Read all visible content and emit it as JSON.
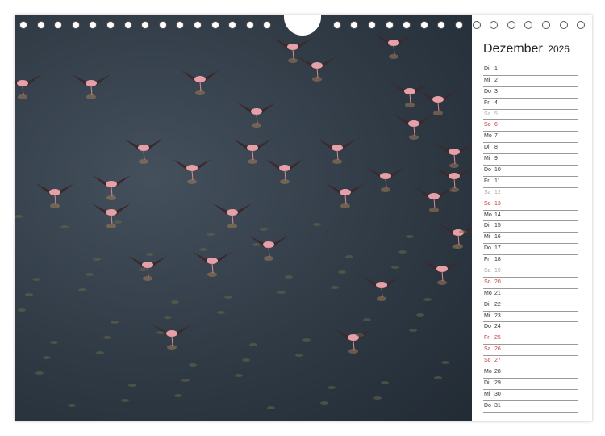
{
  "calendar": {
    "month": "Dezember",
    "year": "2026",
    "days": [
      {
        "weekday": "Di",
        "day": "1",
        "type": "weekday"
      },
      {
        "weekday": "Mi",
        "day": "2",
        "type": "weekday"
      },
      {
        "weekday": "Do",
        "day": "3",
        "type": "weekday"
      },
      {
        "weekday": "Fr",
        "day": "4",
        "type": "weekday"
      },
      {
        "weekday": "Sa",
        "day": "5",
        "type": "sat"
      },
      {
        "weekday": "So",
        "day": "6",
        "type": "sun"
      },
      {
        "weekday": "Mo",
        "day": "7",
        "type": "weekday"
      },
      {
        "weekday": "Di",
        "day": "8",
        "type": "weekday"
      },
      {
        "weekday": "Mi",
        "day": "9",
        "type": "weekday"
      },
      {
        "weekday": "Do",
        "day": "10",
        "type": "weekday"
      },
      {
        "weekday": "Fr",
        "day": "11",
        "type": "weekday"
      },
      {
        "weekday": "Sa",
        "day": "12",
        "type": "sat"
      },
      {
        "weekday": "So",
        "day": "13",
        "type": "sun"
      },
      {
        "weekday": "Mo",
        "day": "14",
        "type": "weekday"
      },
      {
        "weekday": "Di",
        "day": "15",
        "type": "weekday"
      },
      {
        "weekday": "Mi",
        "day": "16",
        "type": "weekday"
      },
      {
        "weekday": "Do",
        "day": "17",
        "type": "weekday"
      },
      {
        "weekday": "Fr",
        "day": "18",
        "type": "weekday"
      },
      {
        "weekday": "Sa",
        "day": "19",
        "type": "sat"
      },
      {
        "weekday": "So",
        "day": "20",
        "type": "sun"
      },
      {
        "weekday": "Mo",
        "day": "21",
        "type": "weekday"
      },
      {
        "weekday": "Di",
        "day": "22",
        "type": "weekday"
      },
      {
        "weekday": "Mi",
        "day": "23",
        "type": "weekday"
      },
      {
        "weekday": "Do",
        "day": "24",
        "type": "weekday"
      },
      {
        "weekday": "Fr",
        "day": "25",
        "type": "hol"
      },
      {
        "weekday": "Sa",
        "day": "26",
        "type": "hol"
      },
      {
        "weekday": "So",
        "day": "27",
        "type": "sun"
      },
      {
        "weekday": "Mo",
        "day": "28",
        "type": "weekday"
      },
      {
        "weekday": "Di",
        "day": "29",
        "type": "weekday"
      },
      {
        "weekday": "Mi",
        "day": "30",
        "type": "weekday"
      },
      {
        "weekday": "Do",
        "day": "31",
        "type": "weekday"
      }
    ]
  },
  "photo": {
    "icon": "flamingo-flock-photo"
  },
  "colors": {
    "sunday": "#c33a3a",
    "saturday": "#aaaaaa",
    "text": "#333333",
    "rule": "#9a9a9a",
    "water": "#2f3a45",
    "flamingo": "#e8a0a8"
  }
}
